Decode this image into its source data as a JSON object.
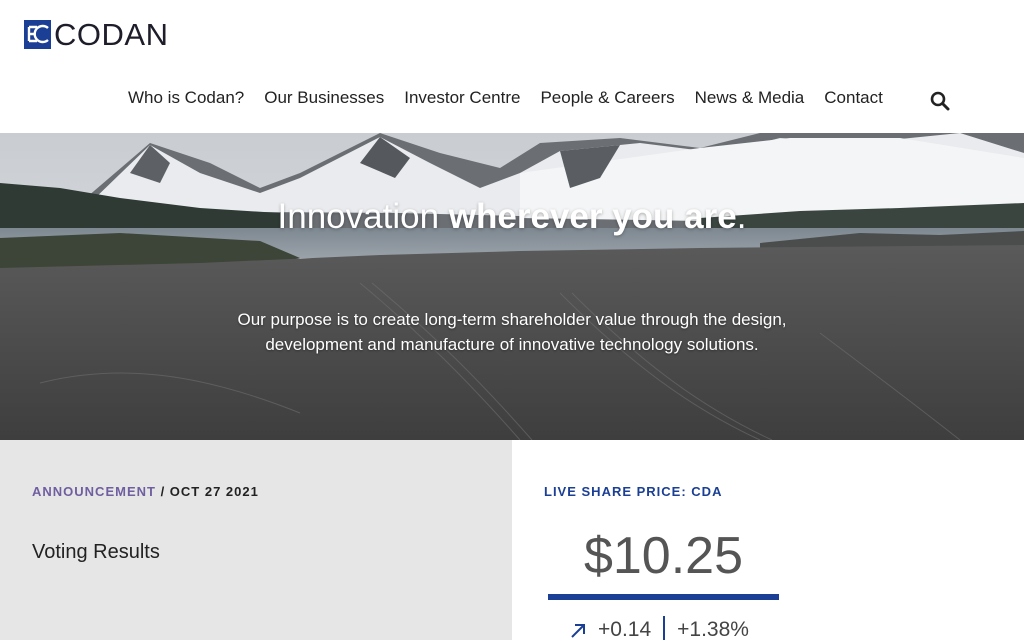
{
  "brand": {
    "name": "CODAN",
    "accent": "#1b3f94",
    "purple": "#6f5ea0"
  },
  "nav": {
    "items": [
      "Who is Codan?",
      "Our Businesses",
      "Investor Centre",
      "People & Careers",
      "News & Media",
      "Contact"
    ],
    "search_icon": "search-icon"
  },
  "hero": {
    "title_light": "Innovation ",
    "title_bold": "wherever you are",
    "title_end": ".",
    "subtitle": "Our purpose is to create long-term shareholder value through the design, development and manufacture of innovative technology solutions."
  },
  "announcement": {
    "type": "ANNOUNCEMENT",
    "separator": " / ",
    "date": "OCT 27 2021",
    "title": "Voting Results"
  },
  "share": {
    "label": "LIVE SHARE PRICE: CDA",
    "price": "$10.25",
    "change": "+0.14",
    "change_pct": "+1.38%",
    "arrow_icon": "arrow-up-right-icon"
  }
}
